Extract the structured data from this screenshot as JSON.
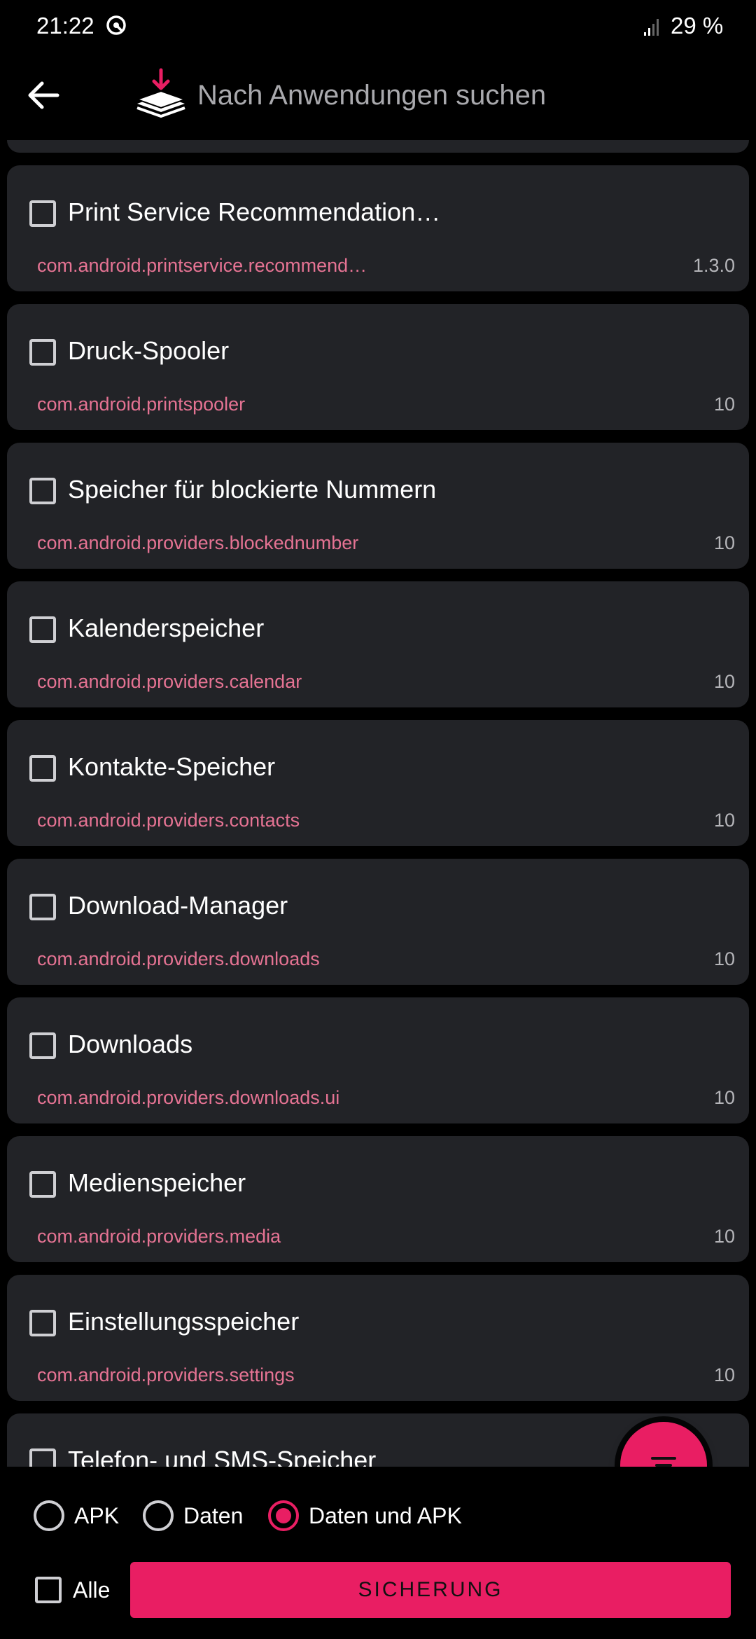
{
  "status_bar": {
    "time": "21:22",
    "battery": "29 %",
    "icons": [
      "vpn-icon",
      "signal-icon"
    ]
  },
  "header": {
    "back_icon": "arrow-left-icon",
    "logo_icon": "app-logo-icon",
    "search_placeholder": "Nach Anwendungen suchen"
  },
  "apps": [
    {
      "name": "Print Service Recommendation…",
      "package": "com.android.printservice.recommend…",
      "version": "1.3.0"
    },
    {
      "name": "Druck-Spooler",
      "package": "com.android.printspooler",
      "version": "10"
    },
    {
      "name": "Speicher für blockierte Nummern",
      "package": "com.android.providers.blockednumber",
      "version": "10"
    },
    {
      "name": "Kalenderspeicher",
      "package": "com.android.providers.calendar",
      "version": "10"
    },
    {
      "name": "Kontakte-Speicher",
      "package": "com.android.providers.contacts",
      "version": "10"
    },
    {
      "name": "Download-Manager",
      "package": "com.android.providers.downloads",
      "version": "10"
    },
    {
      "name": "Downloads",
      "package": "com.android.providers.downloads.ui",
      "version": "10"
    },
    {
      "name": "Medienspeicher",
      "package": "com.android.providers.media",
      "version": "10"
    },
    {
      "name": "Einstellungsspeicher",
      "package": "com.android.providers.settings",
      "version": "10"
    },
    {
      "name": "Telefon- und SMS-Speicher",
      "package": "",
      "version": ""
    }
  ],
  "fab": {
    "icon": "filter-icon"
  },
  "backup_mode": {
    "options": [
      "APK",
      "Daten",
      "Daten und APK"
    ],
    "selected": "Daten und APK"
  },
  "footer": {
    "select_all_label": "Alle",
    "backup_button": "SICHERUNG"
  },
  "colors": {
    "accent": "#e91e63",
    "card_bg": "#222327",
    "package_text": "#e57393"
  }
}
